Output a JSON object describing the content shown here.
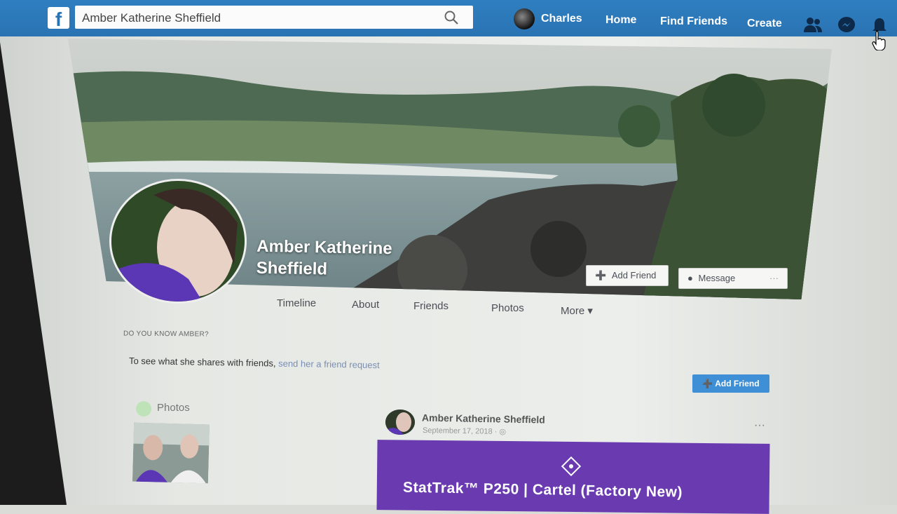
{
  "header": {
    "logo": "f",
    "search_value": "Amber Katherine Sheffield",
    "user_name": "Charles",
    "nav": [
      "Home",
      "Find Friends",
      "Create"
    ],
    "icons": [
      "friends-icon",
      "messenger-icon",
      "notifications-icon"
    ]
  },
  "profile": {
    "name": "Amber Katherine Sheffield",
    "add_friend": "Add Friend",
    "message": "Message",
    "more_dots": "···"
  },
  "tabs": [
    "Timeline",
    "About",
    "Friends",
    "Photos",
    "More ▾"
  ],
  "know": {
    "title": "DO YOU KNOW AMBER?",
    "text": "To see what she shares with friends,",
    "link": "send her a friend request",
    "button": "Add Friend"
  },
  "photos": {
    "heading": "Photos"
  },
  "post": {
    "author": "Amber Katherine Sheffield",
    "date": "September 17, 2018 ·",
    "menu": "···",
    "card_title": "StatTrak™ P250 | Cartel (Factory New)"
  },
  "colors": {
    "brand": "#2a73b3",
    "card": "#6a3bb0"
  }
}
